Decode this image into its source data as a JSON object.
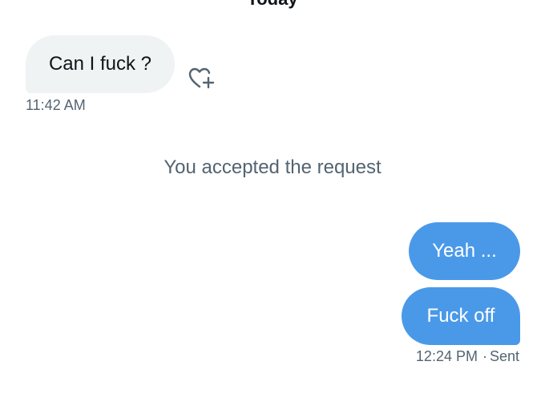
{
  "conversation": {
    "date_header": "Today",
    "messages": [
      {
        "direction": "received",
        "text": "Can I fuck ?",
        "time": "11:42 AM"
      },
      {
        "direction": "sent",
        "text": "Yeah ..."
      },
      {
        "direction": "sent",
        "text": "Fuck off"
      }
    ],
    "system_notice": "You accepted the request",
    "sent_time": "12:24 PM",
    "sent_status": "Sent"
  },
  "icons": {
    "react": "heart-plus-icon"
  },
  "colors": {
    "sent_bubble": "#4a99e9",
    "received_bubble": "#eff3f4",
    "meta_text": "#536471",
    "primary_text": "#0f1419"
  }
}
